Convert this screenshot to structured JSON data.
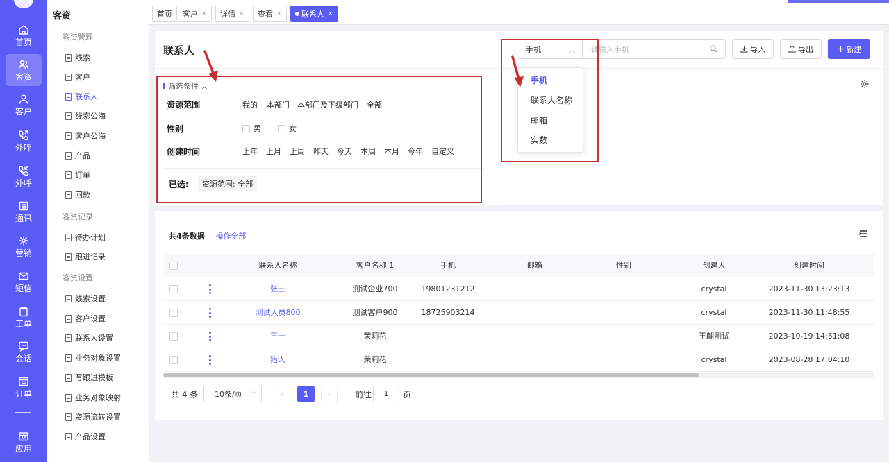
{
  "rail": {
    "items": [
      {
        "label": "首页",
        "icon": "home-icon"
      },
      {
        "label": "客资",
        "icon": "users-icon"
      },
      {
        "label": "客户",
        "icon": "user-icon"
      },
      {
        "label": "外呼",
        "icon": "phone-out-icon"
      },
      {
        "label": "外呼",
        "icon": "phone-in-icon"
      },
      {
        "label": "通讯",
        "icon": "calendar-icon"
      },
      {
        "label": "营销",
        "icon": "marketing-icon"
      },
      {
        "label": "短信",
        "icon": "sms-icon"
      },
      {
        "label": "工单",
        "icon": "clipboard-icon"
      },
      {
        "label": "会话",
        "icon": "chat-icon"
      },
      {
        "label": "订单",
        "icon": "order-icon"
      },
      {
        "label": "应用",
        "icon": "app-icon"
      }
    ]
  },
  "side": {
    "title": "客资",
    "groups": [
      {
        "label": "客资管理",
        "items": [
          "线索",
          "客户",
          "联系人",
          "线索公海",
          "客户公海",
          "产品",
          "订单",
          "回款"
        ]
      },
      {
        "label": "客资记录",
        "items": [
          "待办计划",
          "跟进记录"
        ]
      },
      {
        "label": "客资设置",
        "items": [
          "线索设置",
          "客户设置",
          "联系人设置",
          "业务对象设置",
          "写跟进模板",
          "业务对象映射",
          "资源流转设置",
          "产品设置"
        ]
      }
    ]
  },
  "tabs": [
    {
      "label": "首页",
      "closable": false
    },
    {
      "label": "客户",
      "closable": true
    },
    {
      "label": "详情",
      "closable": true
    },
    {
      "label": "查看",
      "closable": true
    },
    {
      "label": "联系人",
      "closable": true
    }
  ],
  "tab_close": "×",
  "page": {
    "title": "联系人",
    "search_field": "手机",
    "search_placeholder": "请输入手机",
    "import_label": "导入",
    "export_label": "导出",
    "new_label": "新建"
  },
  "filter": {
    "label": "筛选条件",
    "range_label": "资源范围",
    "range_options": [
      "我的",
      "本部门",
      "本部门及下级部门",
      "全部"
    ],
    "gender_label": "性别",
    "gender_options": [
      "男",
      "女"
    ],
    "time_label": "创建时间",
    "time_options": [
      "上年",
      "上月",
      "上周",
      "昨天",
      "今天",
      "本周",
      "本月",
      "今年",
      "自定义"
    ],
    "chosen_label": "已选:",
    "chosen_tag": "资源范围: 全部"
  },
  "dropdown": {
    "options": [
      "手机",
      "联系人名称",
      "邮箱",
      "实数"
    ]
  },
  "table": {
    "count_text": "共4条数据",
    "separator": "|",
    "operate_all": "操作全部",
    "columns": [
      "联系人名称",
      "客户名称 1",
      "手机",
      "邮箱",
      "性别",
      "创建人",
      "创建时间"
    ],
    "rows": [
      {
        "name": "张三",
        "customer": "测试企业700",
        "phone": "19801231212",
        "email": "",
        "gender": "",
        "creator": "crystal",
        "created": "2023-11-30 13:23:13"
      },
      {
        "name": "测试人员800",
        "customer": "测试客户900",
        "phone": "18725903214",
        "email": "",
        "gender": "",
        "creator": "crystal",
        "created": "2023-11-30 11:48:55"
      },
      {
        "name": "王一",
        "customer": "茉莉花",
        "phone": "",
        "email": "",
        "gender": "",
        "creator": "王翩测试",
        "created": "2023-10-19 14:51:08"
      },
      {
        "name": "猎人",
        "customer": "茉莉花",
        "phone": "",
        "email": "",
        "gender": "",
        "creator": "crystal",
        "created": "2023-08-28 17:04:10"
      }
    ]
  },
  "pagination": {
    "total": "共 4 条",
    "page_size": "10条/页",
    "current": "1",
    "goto_label": "前往",
    "goto_value": "1",
    "goto_unit": "页"
  },
  "colors": {
    "brand": "#5b5cf6",
    "annotation": "#c8302e"
  }
}
